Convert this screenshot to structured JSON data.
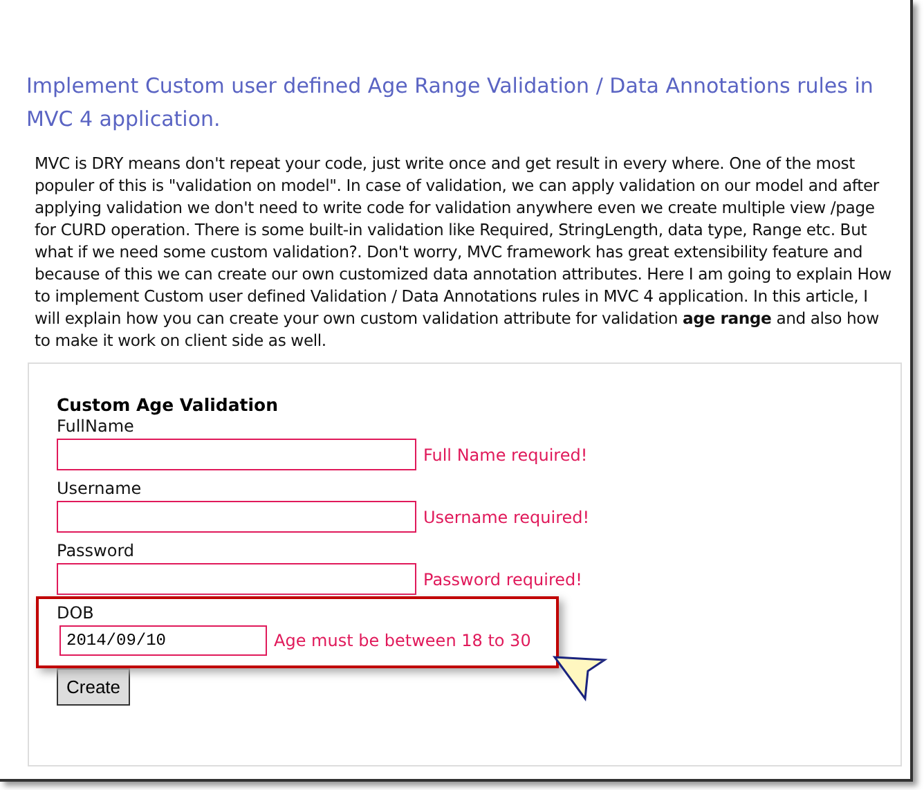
{
  "title": "Implement Custom user defined Age Range Validation / Data Annotations rules in MVC 4 application.",
  "intro": "MVC is DRY  means don't repeat your code, just write once and get result in every where. One of the most populer of this is \"validation on model\". In case of validation, we can apply validation on our model and after applying validation we don't need to write code for validation anywhere even we create multiple view /page for CURD operation. There is some built-in validation like Required, StringLength, data type, Range etc. But what if we need some custom validation?.  Don't worry, MVC framework has great extensibility feature and because of this we can create our own customized data annotation attributes. Here I am going to explain How to implement Custom user defined Validation / Data Annotations rules in MVC 4 application. In this article, I will explain how you can create your own custom validation attribute for validation **age range** and also how to make it work on client side as well.",
  "form": {
    "heading": "Custom Age Validation",
    "fields": [
      {
        "label": "FullName",
        "error": "Full Name required!",
        "highlighted": false
      },
      {
        "label": "Username",
        "error": "Username required!",
        "highlighted": false
      },
      {
        "label": "Password",
        "error": "Password required!",
        "highlighted": false
      },
      {
        "label": "DOB",
        "value": "2014/09/10",
        "error": "Age must be between 18 to 30",
        "highlighted": true
      }
    ],
    "button": "Create"
  }
}
